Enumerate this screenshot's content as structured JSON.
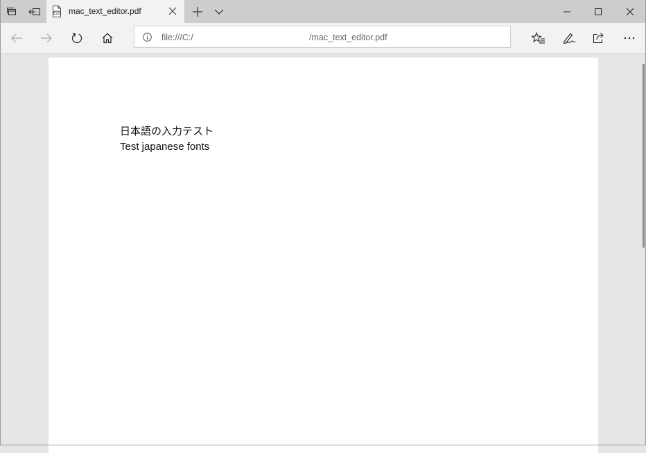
{
  "tab": {
    "title": "mac_text_editor.pdf",
    "file_icon_label": "PDF"
  },
  "address": {
    "url_prefix": "file:///C:/",
    "url_suffix": "/mac_text_editor.pdf"
  },
  "document": {
    "line1": "日本語の入力テスト",
    "line2": "Test japanese fonts"
  },
  "icons": {
    "tab_manager": "tabs-aside-icon",
    "set_aside": "set-aside-icon",
    "close_tab": "close-icon",
    "new_tab": "plus-icon",
    "tab_preview": "chevron-down-icon",
    "minimize": "minimize-icon",
    "maximize": "maximize-icon",
    "close_window": "close-icon",
    "back": "back-arrow-icon",
    "forward": "forward-arrow-icon",
    "refresh": "refresh-icon",
    "home": "home-icon",
    "info": "info-icon",
    "favorites": "favorites-icon",
    "notes": "pen-icon",
    "share": "share-icon",
    "more": "more-icon"
  },
  "colors": {
    "tabbar_bg": "#cdcdcd",
    "active_tab_bg": "#f2f2f2",
    "page_bg": "#ffffff",
    "viewer_bg": "#e6e6e6"
  }
}
